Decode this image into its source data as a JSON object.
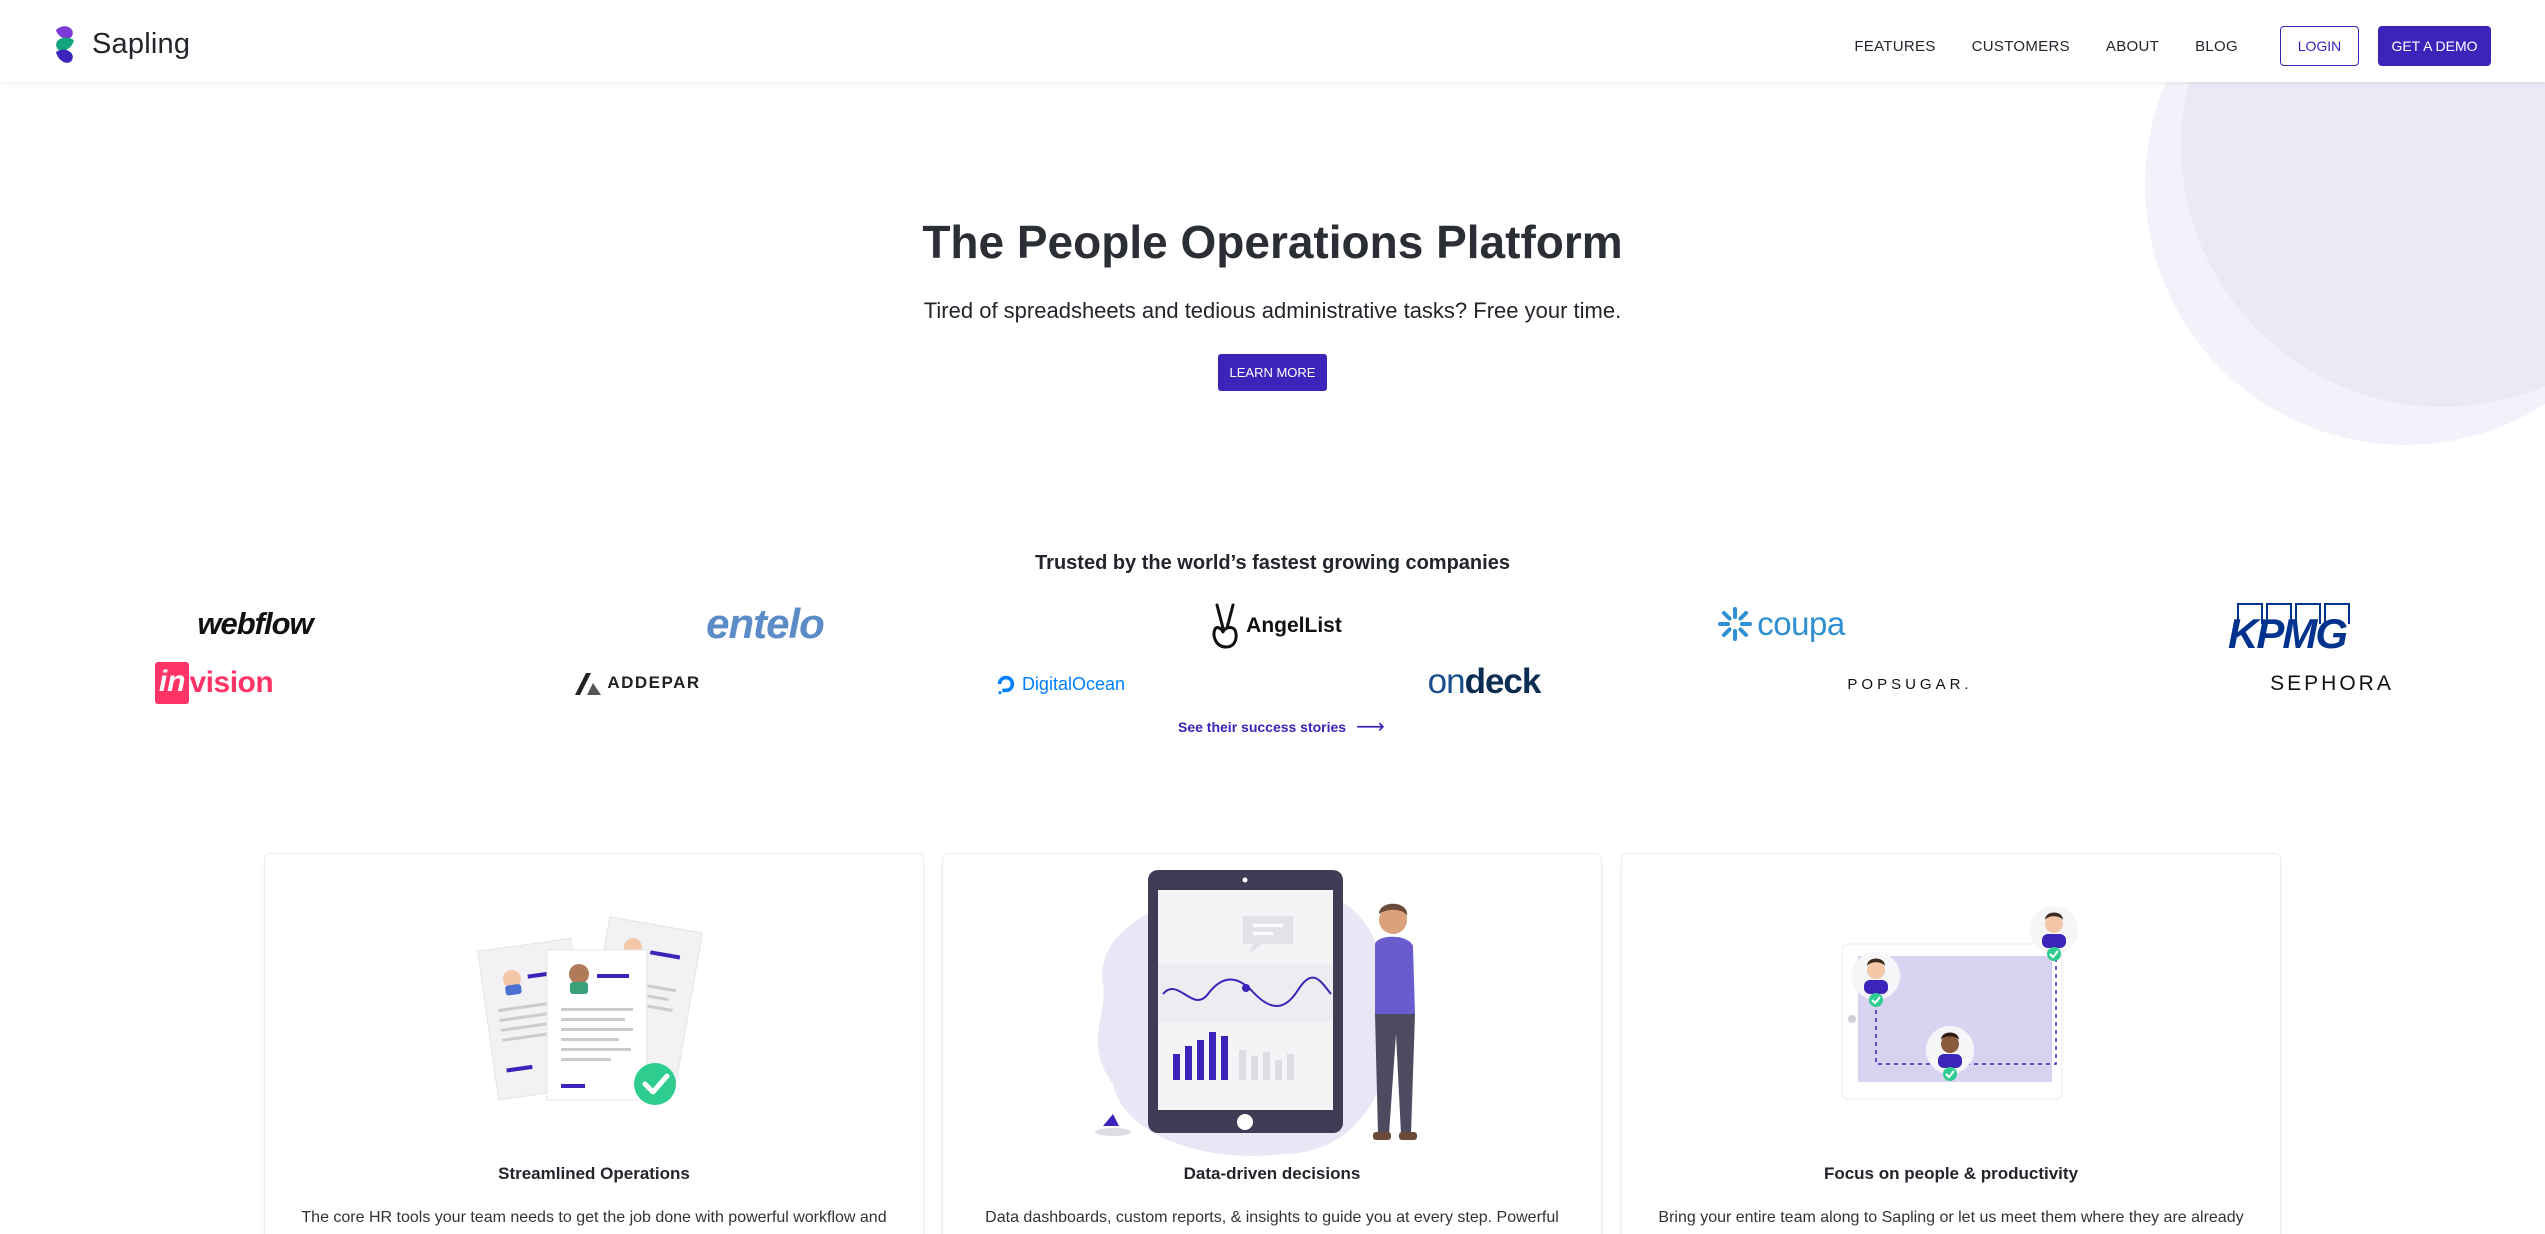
{
  "brand": {
    "name": "Sapling"
  },
  "nav": {
    "links": [
      "FEATURES",
      "CUSTOMERS",
      "ABOUT",
      "BLOG"
    ],
    "login_label": "LOGIN",
    "demo_label": "GET A DEMO"
  },
  "hero": {
    "title": "The People Operations Platform",
    "subtitle": "Tired of spreadsheets and tedious administrative tasks? Free your time.",
    "cta_label": "LEARN MORE"
  },
  "trusted": {
    "title": "Trusted by the world’s fastest growing companies",
    "logos": {
      "webflow": "webflow",
      "entelo": "entelo",
      "angellist": "AngelList",
      "coupa": "coupa",
      "kpmg": "KPMG",
      "invision_in": "in",
      "invision_rest": "vision",
      "addepar": "ADDEPAR",
      "digitalocean": "DigitalOcean",
      "ondeck_on": "on",
      "ondeck_deck": "deck",
      "popsugar": "POPSUGAR.",
      "sephora": "SEPHORA"
    },
    "link_label": "See their success stories",
    "link_arrow": "⟶"
  },
  "features": [
    {
      "title": "Streamlined Operations",
      "description": "The core HR tools your team needs to get the job done with powerful workflow and"
    },
    {
      "title": "Data-driven decisions",
      "description": "Data dashboards, custom reports, & insights to guide you at every step.  Powerful"
    },
    {
      "title": "Focus on people & productivity",
      "description": "Bring your entire team along to Sapling or let us meet them where they are already"
    }
  ],
  "colors": {
    "accent": "#3c23b9",
    "decor": "#ebe9f6",
    "text": "#22252b"
  }
}
